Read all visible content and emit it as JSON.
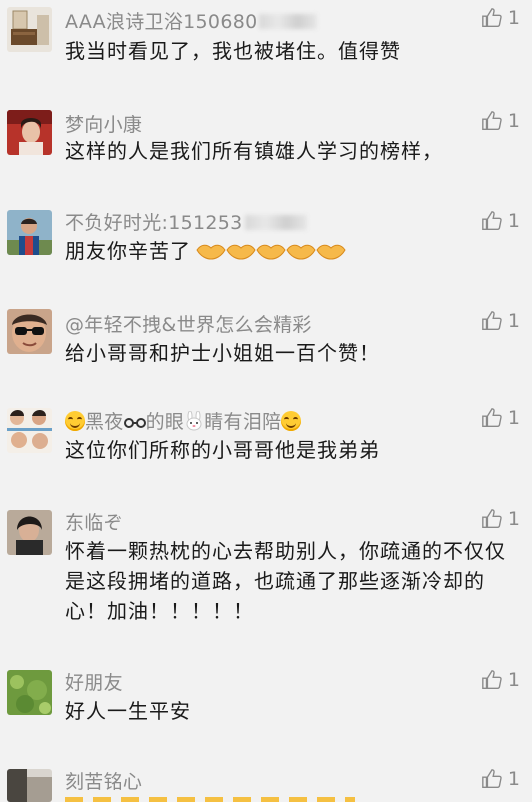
{
  "comments": [
    {
      "username": "AAA浪诗卫浴150680",
      "text": "我当时看见了，我也被堵住。值得赞",
      "likes": "1",
      "avatar_icon": "bathroom-furniture-photo"
    },
    {
      "username": "梦向小康",
      "text": "这样的人是我们所有镇雄人学习的榜样，",
      "likes": "1",
      "avatar_icon": "woman-red-background-photo"
    },
    {
      "username": "不负好时光:151253",
      "text": "朋友你辛苦了",
      "likes": "1",
      "avatar_icon": "man-outdoor-photo",
      "emoji": "handshake-emoji-x5"
    },
    {
      "username": "@年轻不拽&世界怎么会精彩",
      "text": "给小哥哥和护士小姐姐一百个赞！",
      "likes": "1",
      "avatar_icon": "child-sunglasses-photo"
    },
    {
      "username_parts": [
        "黑夜",
        "的眼",
        "睛有泪陪"
      ],
      "text": "这位你们所称的小哥哥他是我弟弟",
      "likes": "1",
      "avatar_icon": "group-collage-photo"
    },
    {
      "username": "东临ぞ",
      "text": "怀着一颗热枕的心去帮助别人，你疏通的不仅仅是这段拥堵的道路，也疏通了那些逐渐冷却的心！加油！！！！！",
      "likes": "1",
      "avatar_icon": "person-dark-hair-photo"
    },
    {
      "username": "好朋友",
      "text": "好人一生平安",
      "likes": "1",
      "avatar_icon": "green-field-photo"
    },
    {
      "username": "刻苦铭心",
      "text": "",
      "likes": "1",
      "avatar_icon": "person-partial-photo"
    }
  ],
  "colors": {
    "background": "#f2f2f2",
    "username": "#8a8a8a",
    "text": "#1a1a1a",
    "like": "#8a8a8a"
  }
}
